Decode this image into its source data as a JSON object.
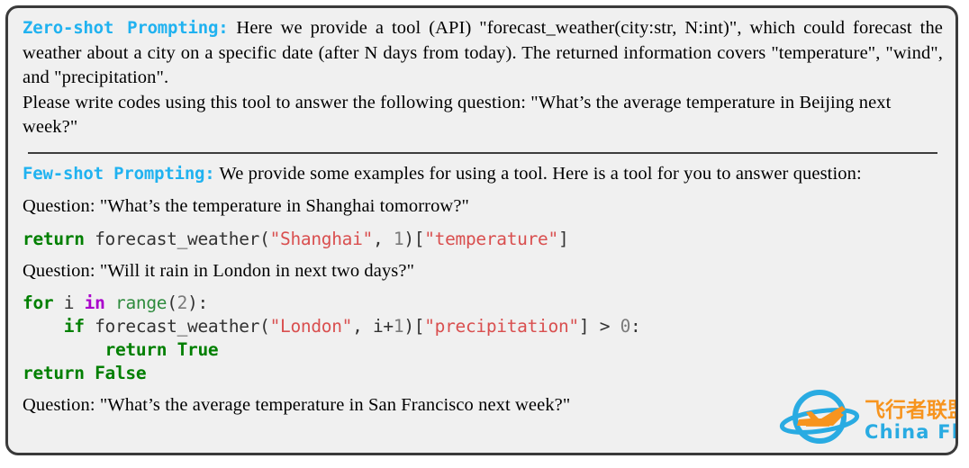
{
  "panel": {
    "background_color": "#f0f0f0",
    "border_color": "#3a3a3a"
  },
  "zero_shot": {
    "tag": "Zero-shot Prompting:",
    "body": " Here we provide a tool (API) \"forecast_weather(city:str, N:int)\", which could forecast the weather about a city on a specific date (after N days from today).  The returned information covers \"temperature\", \"wind\", and \"precipitation\".",
    "instruction": "Please write codes using this tool to answer the following question: \"What’s the average temperature in Beijing next week?\""
  },
  "few_shot": {
    "tag": "Few-shot Prompting:",
    "body": " We provide some examples for using a tool. Here is a tool for you to answer question:",
    "examples": [
      {
        "question": "Question: \"What’s the temperature in Shanghai tomorrow?\"",
        "code_tokens": [
          [
            {
              "t": "return",
              "c": "kw"
            },
            {
              "t": " forecast_weather(",
              "c": "pl"
            },
            {
              "t": "\"Shanghai\"",
              "c": "str"
            },
            {
              "t": ", ",
              "c": "pl"
            },
            {
              "t": "1",
              "c": "num"
            },
            {
              "t": ")[",
              "c": "pl"
            },
            {
              "t": "\"temperature\"",
              "c": "str"
            },
            {
              "t": "]",
              "c": "pl"
            }
          ]
        ]
      },
      {
        "question": "Question: \"Will it rain in London in next two days?\"",
        "code_tokens": [
          [
            {
              "t": "for",
              "c": "kw"
            },
            {
              "t": " i ",
              "c": "pl"
            },
            {
              "t": "in",
              "c": "op"
            },
            {
              "t": " ",
              "c": "pl"
            },
            {
              "t": "range",
              "c": "bi"
            },
            {
              "t": "(",
              "c": "pl"
            },
            {
              "t": "2",
              "c": "num"
            },
            {
              "t": "):",
              "c": "pl"
            }
          ],
          [
            {
              "t": "    ",
              "c": "pl"
            },
            {
              "t": "if",
              "c": "kw"
            },
            {
              "t": " forecast_weather(",
              "c": "pl"
            },
            {
              "t": "\"London\"",
              "c": "str"
            },
            {
              "t": ", i+",
              "c": "pl"
            },
            {
              "t": "1",
              "c": "num"
            },
            {
              "t": ")[",
              "c": "pl"
            },
            {
              "t": "\"precipitation\"",
              "c": "str"
            },
            {
              "t": "] > ",
              "c": "pl"
            },
            {
              "t": "0",
              "c": "num"
            },
            {
              "t": ":",
              "c": "pl"
            }
          ],
          [
            {
              "t": "        ",
              "c": "pl"
            },
            {
              "t": "return True",
              "c": "kw"
            }
          ],
          [
            {
              "t": "return False",
              "c": "kw"
            }
          ]
        ]
      },
      {
        "question": "Question: \"What’s the average temperature in San Francisco next week?\"",
        "code_tokens": []
      }
    ]
  },
  "watermark": {
    "cn_text": "飞行者联盟",
    "en_text": "China Flier",
    "ring_color": "#29abe2",
    "plane_color": "#f7941e",
    "cn_color": "#f7941e",
    "en_color": "#29abe2"
  }
}
